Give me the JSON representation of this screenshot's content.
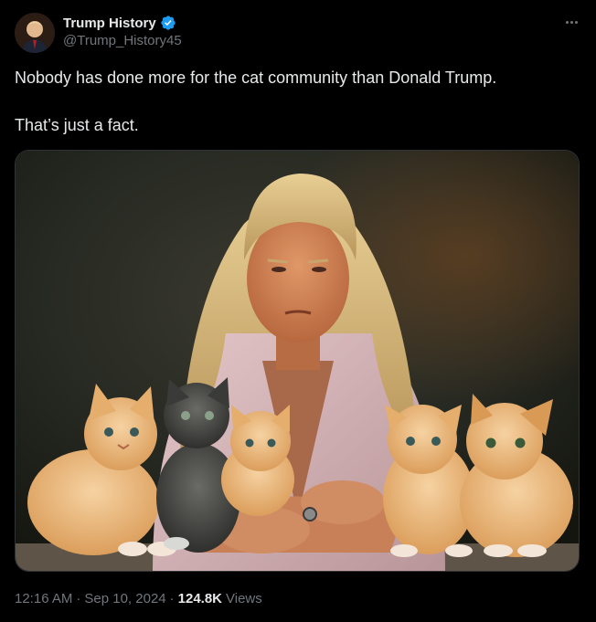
{
  "author": {
    "display_name": "Trump History",
    "handle": "@Trump_History45",
    "verified": true
  },
  "tweet": {
    "line1": "Nobody has done more for the cat community than Donald Trump.",
    "line2": "That’s just a fact."
  },
  "meta": {
    "time": "12:16 AM",
    "sep1": "·",
    "date": "Sep 10, 2024",
    "sep2": "·",
    "views_count": "124.8K",
    "views_label": "Views"
  },
  "icons": {
    "verified": "verified-badge-icon",
    "more": "more-options-icon"
  },
  "colors": {
    "background": "#000000",
    "text": "#e7e9ea",
    "secondary": "#71767b",
    "verified": "#1d9bf0"
  }
}
